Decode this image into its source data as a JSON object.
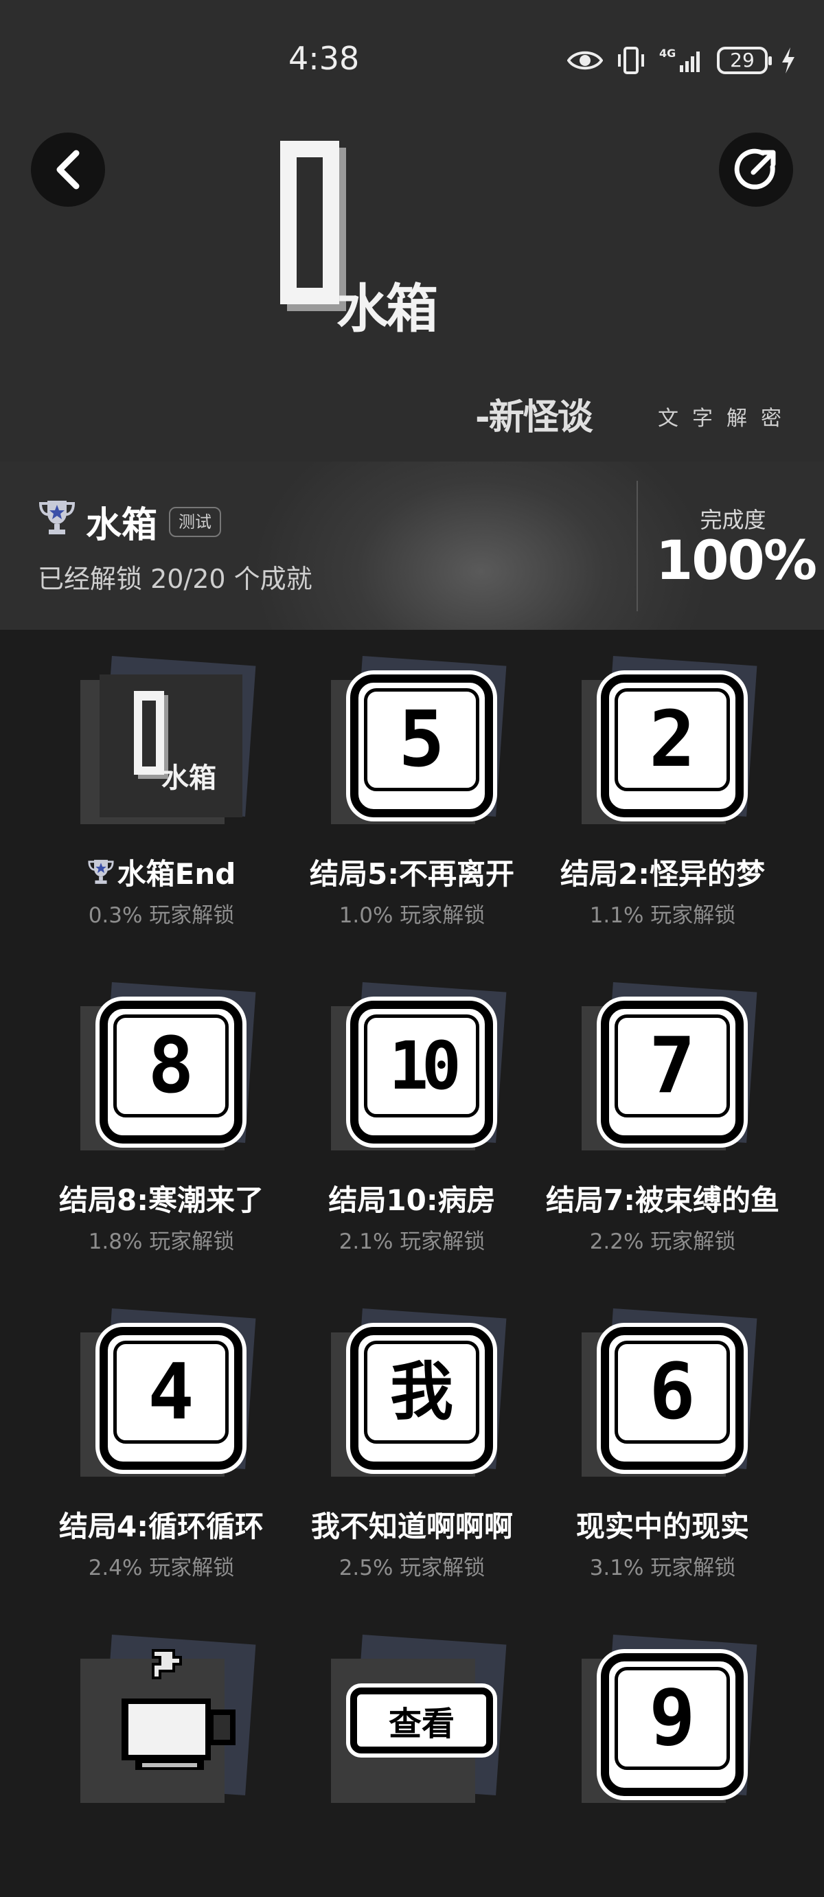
{
  "status_bar": {
    "time": "4:38",
    "battery": "29"
  },
  "header": {
    "logo_text": "水箱",
    "brand": "-新怪谈",
    "brand_sub": "文字解密"
  },
  "game": {
    "name": "水箱",
    "tag": "测试",
    "unlock_text": "已经解锁 20/20 个成就",
    "progress_label": "完成度",
    "progress_value": "100%",
    "progress_fraction": 1.0
  },
  "achievements": [
    {
      "title": "水箱End",
      "sub": "0.3% 玩家解锁",
      "tile": "logo",
      "logo_text": "水箱"
    },
    {
      "title": "结局5:不再离开",
      "sub": "1.0% 玩家解锁",
      "tile": "5"
    },
    {
      "title": "结局2:怪异的梦",
      "sub": "1.1% 玩家解锁",
      "tile": "2"
    },
    {
      "title": "结局8:寒潮来了",
      "sub": "1.8% 玩家解锁",
      "tile": "8"
    },
    {
      "title": "结局10:病房",
      "sub": "2.1% 玩家解锁",
      "tile": "10"
    },
    {
      "title": "结局7:被束缚的鱼",
      "sub": "2.2% 玩家解锁",
      "tile": "7"
    },
    {
      "title": "结局4:循环循环",
      "sub": "2.4% 玩家解锁",
      "tile": "4"
    },
    {
      "title": "我不知道啊啊啊",
      "sub": "2.5% 玩家解锁",
      "tile": "我"
    },
    {
      "title": "现实中的现实",
      "sub": "3.1% 玩家解锁",
      "tile": "6"
    },
    {
      "tile": "cup"
    },
    {
      "tile": "查看"
    },
    {
      "tile": "9"
    }
  ],
  "colors": {
    "background": "#1c1c1c",
    "header": "#2d2d2d",
    "tile_accent": "#353a48",
    "muted_text": "#8e8e8e"
  },
  "icons": [
    "back-arrow-icon",
    "share-icon",
    "trophy-icon",
    "eye-icon",
    "vibrate-icon",
    "signal-icon",
    "battery-icon",
    "charging-bolt-icon"
  ]
}
